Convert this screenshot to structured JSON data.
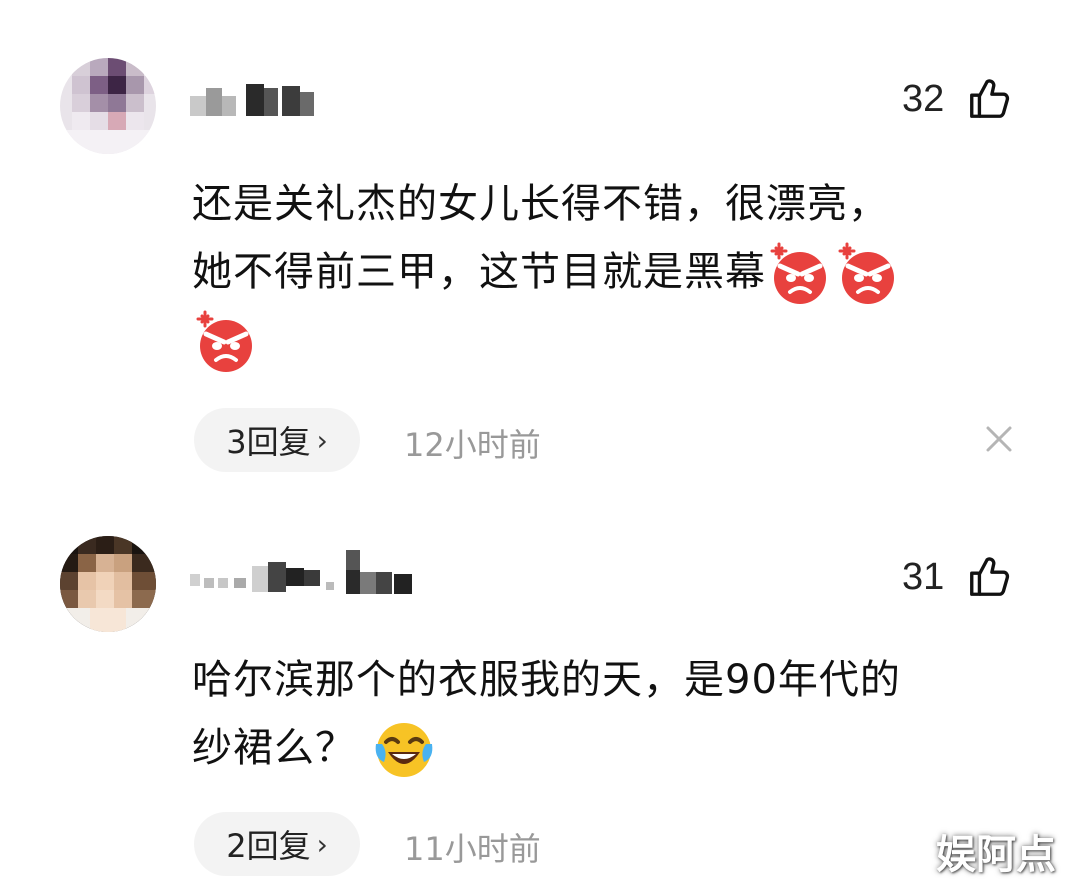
{
  "comments": [
    {
      "username": "",
      "like_count": "32",
      "text_line1": "还是关礼杰的女儿长得不错，很漂亮，",
      "text_line2": "她不得前三甲，这节目就是黑幕",
      "reply_label": "3回复",
      "reply_chevron": "›",
      "timestamp": "12小时前",
      "emojis": [
        "angry-face-emoji",
        "angry-face-emoji",
        "angry-face-emoji"
      ]
    },
    {
      "username": "",
      "like_count": "31",
      "text_line1": "哈尔滨那个的衣服我的天，是90年代的",
      "text_line2": "纱裙么？",
      "reply_label": "2回复",
      "reply_chevron": "›",
      "timestamp": "11小时前",
      "emojis": [
        "laughing-crying-emoji"
      ]
    }
  ],
  "watermark": "娱阿点",
  "colors": {
    "background": "#ffffff",
    "text": "#111111",
    "timestamp": "#999999",
    "reply_bg": "#f3f3f3",
    "angry_red": "#e8413e"
  }
}
